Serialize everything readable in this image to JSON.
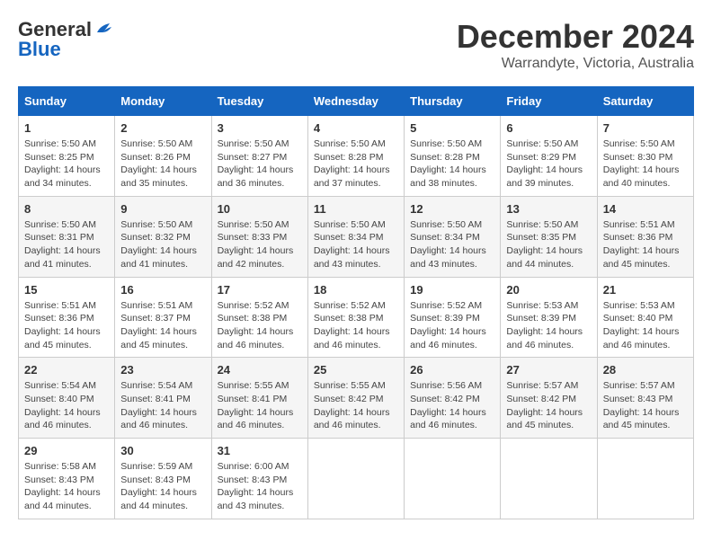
{
  "logo": {
    "general": "General",
    "blue": "Blue"
  },
  "header": {
    "month": "December 2024",
    "location": "Warrandyte, Victoria, Australia"
  },
  "weekdays": [
    "Sunday",
    "Monday",
    "Tuesday",
    "Wednesday",
    "Thursday",
    "Friday",
    "Saturday"
  ],
  "weeks": [
    [
      {
        "day": "1",
        "info": "Sunrise: 5:50 AM\nSunset: 8:25 PM\nDaylight: 14 hours\nand 34 minutes."
      },
      {
        "day": "2",
        "info": "Sunrise: 5:50 AM\nSunset: 8:26 PM\nDaylight: 14 hours\nand 35 minutes."
      },
      {
        "day": "3",
        "info": "Sunrise: 5:50 AM\nSunset: 8:27 PM\nDaylight: 14 hours\nand 36 minutes."
      },
      {
        "day": "4",
        "info": "Sunrise: 5:50 AM\nSunset: 8:28 PM\nDaylight: 14 hours\nand 37 minutes."
      },
      {
        "day": "5",
        "info": "Sunrise: 5:50 AM\nSunset: 8:28 PM\nDaylight: 14 hours\nand 38 minutes."
      },
      {
        "day": "6",
        "info": "Sunrise: 5:50 AM\nSunset: 8:29 PM\nDaylight: 14 hours\nand 39 minutes."
      },
      {
        "day": "7",
        "info": "Sunrise: 5:50 AM\nSunset: 8:30 PM\nDaylight: 14 hours\nand 40 minutes."
      }
    ],
    [
      {
        "day": "8",
        "info": "Sunrise: 5:50 AM\nSunset: 8:31 PM\nDaylight: 14 hours\nand 41 minutes."
      },
      {
        "day": "9",
        "info": "Sunrise: 5:50 AM\nSunset: 8:32 PM\nDaylight: 14 hours\nand 41 minutes."
      },
      {
        "day": "10",
        "info": "Sunrise: 5:50 AM\nSunset: 8:33 PM\nDaylight: 14 hours\nand 42 minutes."
      },
      {
        "day": "11",
        "info": "Sunrise: 5:50 AM\nSunset: 8:34 PM\nDaylight: 14 hours\nand 43 minutes."
      },
      {
        "day": "12",
        "info": "Sunrise: 5:50 AM\nSunset: 8:34 PM\nDaylight: 14 hours\nand 43 minutes."
      },
      {
        "day": "13",
        "info": "Sunrise: 5:50 AM\nSunset: 8:35 PM\nDaylight: 14 hours\nand 44 minutes."
      },
      {
        "day": "14",
        "info": "Sunrise: 5:51 AM\nSunset: 8:36 PM\nDaylight: 14 hours\nand 45 minutes."
      }
    ],
    [
      {
        "day": "15",
        "info": "Sunrise: 5:51 AM\nSunset: 8:36 PM\nDaylight: 14 hours\nand 45 minutes."
      },
      {
        "day": "16",
        "info": "Sunrise: 5:51 AM\nSunset: 8:37 PM\nDaylight: 14 hours\nand 45 minutes."
      },
      {
        "day": "17",
        "info": "Sunrise: 5:52 AM\nSunset: 8:38 PM\nDaylight: 14 hours\nand 46 minutes."
      },
      {
        "day": "18",
        "info": "Sunrise: 5:52 AM\nSunset: 8:38 PM\nDaylight: 14 hours\nand 46 minutes."
      },
      {
        "day": "19",
        "info": "Sunrise: 5:52 AM\nSunset: 8:39 PM\nDaylight: 14 hours\nand 46 minutes."
      },
      {
        "day": "20",
        "info": "Sunrise: 5:53 AM\nSunset: 8:39 PM\nDaylight: 14 hours\nand 46 minutes."
      },
      {
        "day": "21",
        "info": "Sunrise: 5:53 AM\nSunset: 8:40 PM\nDaylight: 14 hours\nand 46 minutes."
      }
    ],
    [
      {
        "day": "22",
        "info": "Sunrise: 5:54 AM\nSunset: 8:40 PM\nDaylight: 14 hours\nand 46 minutes."
      },
      {
        "day": "23",
        "info": "Sunrise: 5:54 AM\nSunset: 8:41 PM\nDaylight: 14 hours\nand 46 minutes."
      },
      {
        "day": "24",
        "info": "Sunrise: 5:55 AM\nSunset: 8:41 PM\nDaylight: 14 hours\nand 46 minutes."
      },
      {
        "day": "25",
        "info": "Sunrise: 5:55 AM\nSunset: 8:42 PM\nDaylight: 14 hours\nand 46 minutes."
      },
      {
        "day": "26",
        "info": "Sunrise: 5:56 AM\nSunset: 8:42 PM\nDaylight: 14 hours\nand 46 minutes."
      },
      {
        "day": "27",
        "info": "Sunrise: 5:57 AM\nSunset: 8:42 PM\nDaylight: 14 hours\nand 45 minutes."
      },
      {
        "day": "28",
        "info": "Sunrise: 5:57 AM\nSunset: 8:43 PM\nDaylight: 14 hours\nand 45 minutes."
      }
    ],
    [
      {
        "day": "29",
        "info": "Sunrise: 5:58 AM\nSunset: 8:43 PM\nDaylight: 14 hours\nand 44 minutes."
      },
      {
        "day": "30",
        "info": "Sunrise: 5:59 AM\nSunset: 8:43 PM\nDaylight: 14 hours\nand 44 minutes."
      },
      {
        "day": "31",
        "info": "Sunrise: 6:00 AM\nSunset: 8:43 PM\nDaylight: 14 hours\nand 43 minutes."
      },
      {
        "day": "",
        "info": ""
      },
      {
        "day": "",
        "info": ""
      },
      {
        "day": "",
        "info": ""
      },
      {
        "day": "",
        "info": ""
      }
    ]
  ]
}
